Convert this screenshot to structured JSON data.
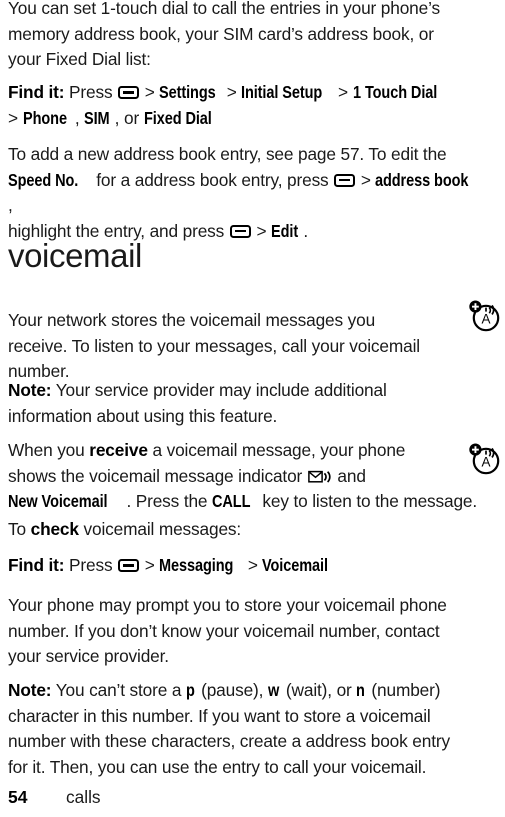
{
  "document": {
    "background_color": "#ffffff",
    "text_color": "#1a1a1a"
  },
  "icons": {
    "menu_key": "menu-key-icon",
    "voicemail_indicator": "voicemail-message-indicator-icon",
    "network_margin": "network-personalize-icon"
  },
  "blocks": {
    "intro": {
      "line1": "You can set 1-touch dial to call the entries in your phone’s",
      "line2": "memory address book, your SIM card’s address book, or",
      "line3": "your Fixed Dial list:"
    },
    "find_it_1": {
      "label": "Find it:",
      "press": "Press",
      "gt1": ">",
      "item1": "Settings",
      "gt2": ">",
      "item2": "Initial Setup",
      "gt3": ">",
      "item3": "1 Touch Dial",
      "gt4": ">",
      "item4": "Phone",
      "comma1": ",",
      "item5": "SIM",
      "comma2": ",",
      "or": "or",
      "item6": "Fixed Dial"
    },
    "edit_entry": {
      "t1": "To add a new address book entry, see page 57. To edit the",
      "t2_bold": "Speed No.",
      "t3": " for a address book entry, press ",
      "t4_gt": ">",
      "t5_bold": "address book",
      "t6": ",",
      "t7": "highlight the entry, and press ",
      "t8_gt": ">",
      "t9_bold": "Edit",
      "t10": "."
    },
    "heading": "voicemail",
    "network_stores": {
      "line1": "Your network stores the voicemail messages you",
      "line2": "receive. To listen to your messages, call your voicemail",
      "line3": "number."
    },
    "note_1": {
      "label": "Note:",
      "text1": " Your service provider may include additional",
      "text2": "information about using this feature."
    },
    "receive": {
      "p1": "When you ",
      "bold1": "receive",
      "p2": " a voicemail message, your phone",
      "p3": "shows the voicemail message indicator ",
      "p4": " and",
      "bold2": "New Voicemail",
      "p5": ". Press the ",
      "bold3": "CALL",
      "p6": " key to listen to the message."
    },
    "to_check": {
      "p1": "To ",
      "bold": "check",
      "p2": " voicemail messages:"
    },
    "find_it_2": {
      "label": "Find it:",
      "press": "Press",
      "gt1": ">",
      "item1": "Messaging",
      "gt2": ">",
      "item2": "Voicemail"
    },
    "prompt_store": {
      "line1": "Your phone may prompt you to store your voicemail phone",
      "line2": "number. If you don’t know your voicemail number, contact",
      "line3": "your service provider."
    },
    "note_2": {
      "label": "Note:",
      "p1": " You can’t store a ",
      "b1": "p",
      "p2": " (pause), ",
      "b2": "w",
      "p3": " (wait), or ",
      "b3": "n",
      "p4": " (number)",
      "line2": "character in this number. If you want to store a voicemail",
      "line3": "number with these characters, create a address book entry",
      "line4": "for it. Then, you can use the entry to call your voicemail."
    }
  },
  "footer": {
    "page_number": "54",
    "chapter": "calls"
  }
}
